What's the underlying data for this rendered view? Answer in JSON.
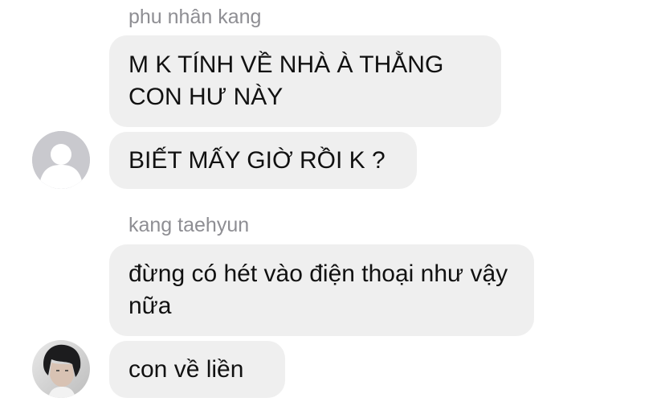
{
  "conversation": {
    "groups": [
      {
        "sender": "phu nhân kang",
        "messages": [
          "M K TÍNH VỀ NHÀ À THẰNG CON HƯ NÀY",
          "BIẾT MẤY GIỜ RỒI K ?"
        ],
        "avatar": "default-avatar-icon"
      },
      {
        "sender": "kang taehyun",
        "messages": [
          "đừng có hét vào điện thoại như vậy nữa",
          "con về liền"
        ],
        "avatar": "profile-photo"
      }
    ]
  },
  "colors": {
    "bubble": "#efefef",
    "sender_name": "#8e8e93",
    "text": "#111111",
    "default_avatar": "#c7c7cc"
  }
}
